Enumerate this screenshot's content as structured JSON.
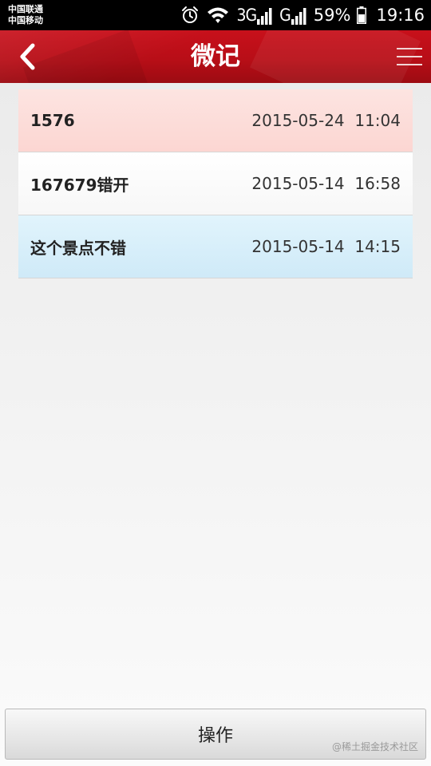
{
  "status_bar": {
    "carrier_1": "中国联通",
    "carrier_2": "中国移动",
    "network_1": "3G",
    "network_2": "G",
    "battery_percent": "59%",
    "time": "19:16"
  },
  "header": {
    "title": "微记",
    "back_icon": "chevron-left-icon",
    "menu_icon": "hamburger-menu-icon"
  },
  "notes": [
    {
      "title": "1576",
      "datetime": "2015-05-24  11:04"
    },
    {
      "title": "167679错开",
      "datetime": "2015-05-14  16:58"
    },
    {
      "title": "这个景点不错",
      "datetime": "2015-05-14  14:15"
    }
  ],
  "footer": {
    "action_label": "操作",
    "watermark": "@稀土掘金技术社区"
  },
  "colors": {
    "header_red": "#b80e17",
    "row_pink": "#fcd6d2",
    "row_white": "#ffffff",
    "row_blue": "#cfeaf8"
  }
}
